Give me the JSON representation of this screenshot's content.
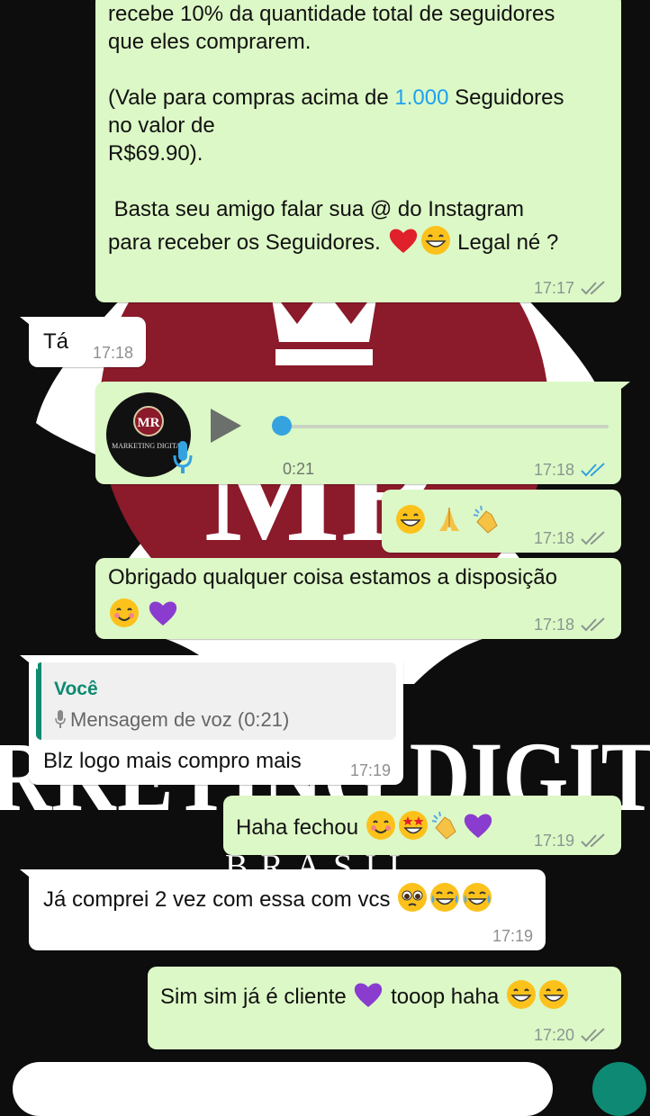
{
  "colors": {
    "outgoing_bubble": "#dcf8c6",
    "incoming_bubble": "#ffffff",
    "wallpaper_background": "#0d0d0d",
    "wallpaper_logo_red": "#8b1a2a",
    "read_tick": "#34a3e0",
    "quote_accent": "#0d8a6f"
  },
  "messages": [
    {
      "id": "m1",
      "direction": "outgoing",
      "line1": "recebe 10% da quantidade total de seguidores",
      "line2": "que eles comprarem.",
      "line3_pre": "(Vale para compras acima de ",
      "line3_link": "1.000",
      "line3_post": " Seguidores",
      "line4": "no valor de",
      "line5": "R$69.90).",
      "line6": " Basta seu amigo falar sua @ do Instagram",
      "line7_text": "para receber os Seguidores. ",
      "line7_emojis": [
        "red-heart",
        "grinning-face"
      ],
      "line7_tail": " Legal né ?",
      "time": "17:17",
      "status": "delivered"
    },
    {
      "id": "m2",
      "direction": "incoming",
      "text": "Tá",
      "time": "17:18"
    },
    {
      "id": "m3",
      "direction": "outgoing",
      "type": "voice",
      "avatar_initials": "MR",
      "avatar_caption": "MARKETING DIGITAL",
      "duration": "0:21",
      "progress": 0,
      "time": "17:18",
      "status": "read"
    },
    {
      "id": "m4",
      "direction": "outgoing",
      "emojis": [
        "grinning-face",
        "folded-hands",
        "clapping-hands"
      ],
      "time": "17:18",
      "status": "delivered"
    },
    {
      "id": "m5",
      "direction": "outgoing",
      "text": "Obrigado qualquer coisa estamos a disposição",
      "emojis": [
        "smiling-face",
        "purple-heart"
      ],
      "time": "17:18",
      "status": "delivered"
    },
    {
      "id": "m6",
      "direction": "incoming",
      "quote_author": "Você",
      "quote_text": "Mensagem de voz (0:21)",
      "text": "Blz logo mais compro mais",
      "time": "17:19"
    },
    {
      "id": "m7",
      "direction": "outgoing",
      "text": "Haha fechou ",
      "emojis": [
        "smiling-face",
        "star-struck",
        "clapping-hands",
        "purple-heart"
      ],
      "time": "17:19",
      "status": "delivered"
    },
    {
      "id": "m8",
      "direction": "incoming",
      "text": "Já comprei 2 vez com essa com vcs ",
      "emojis": [
        "pleading-face",
        "tears-of-joy",
        "tears-of-joy"
      ],
      "time": "17:19"
    },
    {
      "id": "m9",
      "direction": "outgoing",
      "text": "Sim sim já é cliente ",
      "emoji_mid": "purple-heart",
      "text_after": " tooop haha ",
      "emojis": [
        "grinning-face",
        "grinning-face"
      ],
      "time": "17:20",
      "status": "delivered"
    }
  ],
  "wallpaper": {
    "logo_initials": "MR",
    "brand_text": "RKETING DIGIT",
    "sub_text": "BRASIL"
  }
}
